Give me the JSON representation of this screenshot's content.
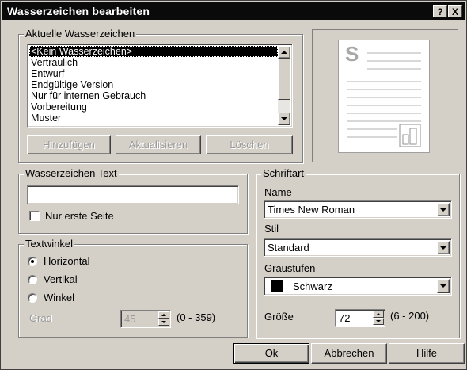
{
  "dialog": {
    "title": "Wasserzeichen bearbeiten",
    "help_button": "?",
    "close_button": "X"
  },
  "current_watermarks": {
    "legend": "Aktuelle Wasserzeichen",
    "items": [
      {
        "label": "<Kein Wasserzeichen>",
        "selected": true
      },
      {
        "label": "Vertraulich",
        "selected": false
      },
      {
        "label": "Entwurf",
        "selected": false
      },
      {
        "label": "Endgültige Version",
        "selected": false
      },
      {
        "label": "Nur für internen Gebrauch",
        "selected": false
      },
      {
        "label": "Vorbereitung",
        "selected": false
      },
      {
        "label": "Muster",
        "selected": false
      }
    ],
    "buttons": {
      "add": "Hinzufügen",
      "update": "Aktualisieren",
      "delete": "Löschen"
    }
  },
  "preview": {
    "letter": "S"
  },
  "watermark_text": {
    "legend": "Wasserzeichen Text",
    "value": "",
    "first_page_only": "Nur erste Seite",
    "first_page_only_checked": false
  },
  "angle": {
    "legend": "Textwinkel",
    "options": [
      {
        "label": "Horizontal",
        "selected": true
      },
      {
        "label": "Vertikal",
        "selected": false
      },
      {
        "label": "Winkel",
        "selected": false
      }
    ],
    "degree_label": "Grad",
    "degree_value": "45",
    "degree_range": "(0 - 359)"
  },
  "font": {
    "legend": "Schriftart",
    "name_label": "Name",
    "name_value": "Times New Roman",
    "style_label": "Stil",
    "style_value": "Standard",
    "gray_label": "Graustufen",
    "gray_value": "Schwarz",
    "gray_swatch": "#000000",
    "size_label": "Größe",
    "size_value": "72",
    "size_range": "(6 - 200)"
  },
  "footer": {
    "ok": "Ok",
    "cancel": "Abbrechen",
    "help": "Hilfe"
  }
}
